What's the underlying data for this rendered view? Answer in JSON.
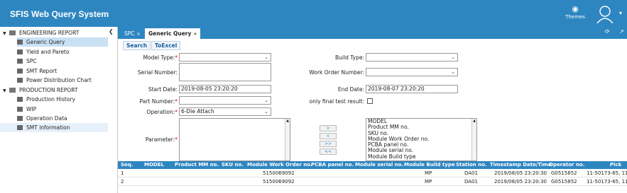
{
  "app": {
    "title": "SFIS Web Query System",
    "themes_label": "Themes"
  },
  "sidebar": {
    "items": [
      {
        "label": "ENGINEERING REPORT",
        "type": "folder"
      },
      {
        "label": "Generic Query",
        "type": "leaf",
        "selected": true
      },
      {
        "label": "Yield and Pareto",
        "type": "leaf"
      },
      {
        "label": "SPC",
        "type": "leaf"
      },
      {
        "label": "SMT Report",
        "type": "leaf"
      },
      {
        "label": "Power Distribution Chart",
        "type": "leaf"
      },
      {
        "label": "PRODUCTION REPORT",
        "type": "folder"
      },
      {
        "label": "Production History",
        "type": "leaf"
      },
      {
        "label": "WIP",
        "type": "leaf"
      },
      {
        "label": "Operation Data",
        "type": "leaf"
      },
      {
        "label": "SMT information",
        "type": "leaf",
        "highlighted": true
      }
    ]
  },
  "tabs": [
    {
      "label": "SPC"
    },
    {
      "label": "Generic Query",
      "active": true
    }
  ],
  "toolbar": {
    "search_label": "Search",
    "toexcel_label": "ToExcel"
  },
  "form": {
    "model_type": {
      "label": "Model Type:",
      "value": ""
    },
    "build_type": {
      "label": "Build Type:",
      "value": ""
    },
    "serial_number": {
      "label": "Serial Number:",
      "value": ""
    },
    "work_order_number": {
      "label": "Work Order Number:",
      "value": ""
    },
    "start_date": {
      "label": "Start Date:",
      "value": "2019-08-05 23:20:20"
    },
    "end_date": {
      "label": "End Date:",
      "value": "2019-08-07 23:20:20"
    },
    "part_number": {
      "label": "Part Number:",
      "value": ""
    },
    "only_final": {
      "label": "only final test result:",
      "checked": false
    },
    "operation": {
      "label": "Operation:",
      "value": "6-Die Attach"
    },
    "parameter": {
      "label": "Parameter:"
    },
    "buttons": [
      ">",
      "<",
      ">>",
      "<<"
    ],
    "available_fields": [
      "MODEL",
      "Product MM no.",
      "SKU no.",
      "Module Work Order no.",
      "PCBA panel no.",
      "Module serial no.",
      "Module Build type"
    ]
  },
  "grid": {
    "columns": [
      "Seq.",
      "MODEL",
      "Product MM no.",
      "SKU no.",
      "Module Work Order no.",
      "PCBA panel no.",
      "Module serial no.",
      "Module Build type",
      "Station no.",
      "Timestamp Date/Time",
      "Operator no.",
      "Pick"
    ],
    "rows": [
      {
        "seq": "1",
        "model": "",
        "product_mm": "",
        "sku": "",
        "work_order": "5150069092",
        "pcba": "",
        "serial": "",
        "build_type": "MP",
        "station": "DA01",
        "timestamp": "2019/08/05 23:20:30",
        "operator": "G0515852",
        "pick": "11-50173-65, 11"
      },
      {
        "seq": "2",
        "model": "",
        "product_mm": "",
        "sku": "",
        "work_order": "5150069092",
        "pcba": "",
        "serial": "",
        "build_type": "MP",
        "station": "DA01",
        "timestamp": "2019/08/05 23:20:30",
        "operator": "G0515852",
        "pick": "11-50173-65, 11"
      }
    ]
  },
  "colors": {
    "accent": "#2e86c1",
    "selected": "#c9e1f5",
    "required": "#dd0000"
  }
}
